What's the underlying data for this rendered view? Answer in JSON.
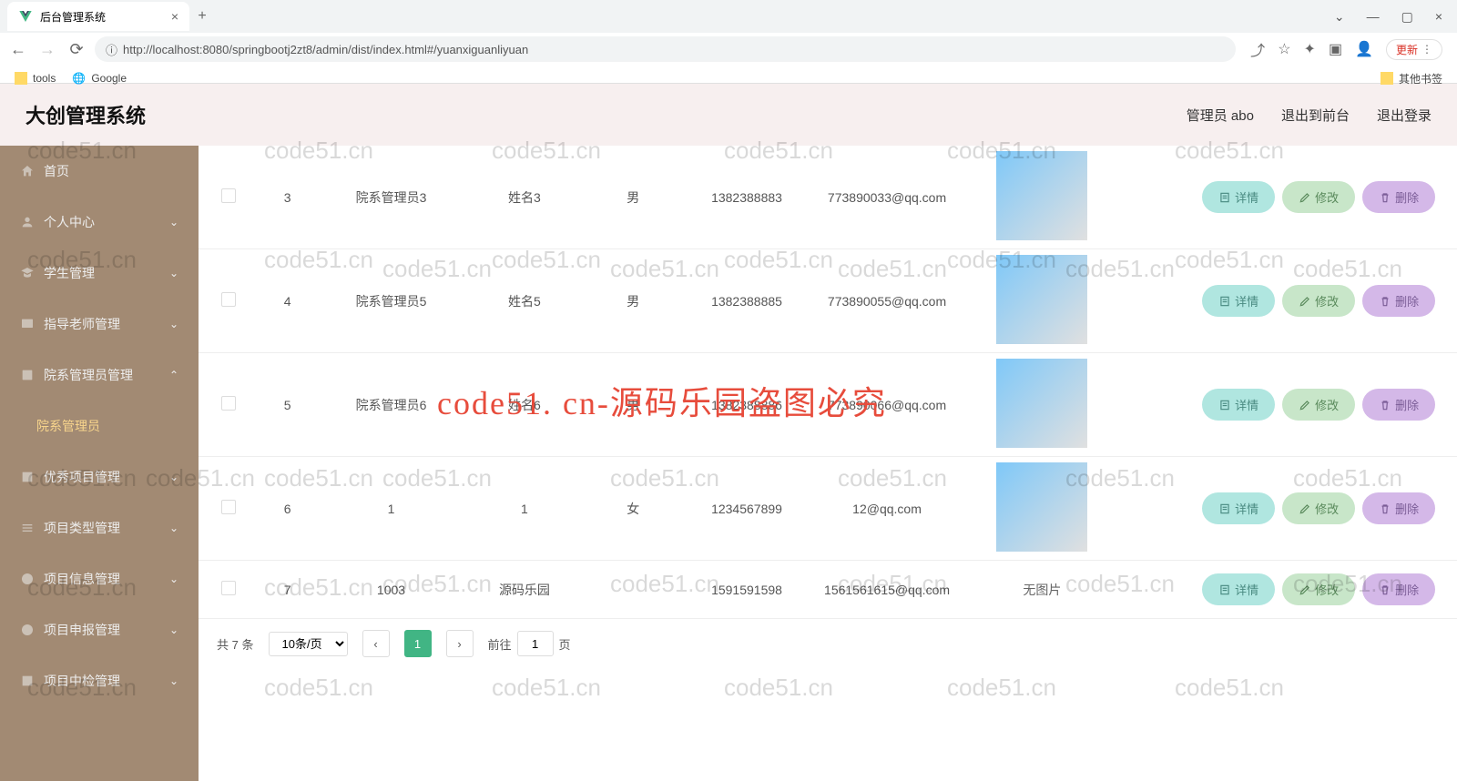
{
  "browser": {
    "tab_title": "后台管理系统",
    "url": "http://localhost:8080/springbootj2zt8/admin/dist/index.html#/yuanxiguanliyuan",
    "update_label": "更新",
    "bookmarks": {
      "tools": "tools",
      "google": "Google",
      "other": "其他书签"
    }
  },
  "header": {
    "app_title": "大创管理系统",
    "user_label": "管理员 abo",
    "logout_front": "退出到前台",
    "logout": "退出登录"
  },
  "sidebar": {
    "items": [
      {
        "label": "首页",
        "icon": "home"
      },
      {
        "label": "个人中心",
        "icon": "user"
      },
      {
        "label": "学生管理",
        "icon": "student"
      },
      {
        "label": "指导老师管理",
        "icon": "teacher"
      },
      {
        "label": "院系管理员管理",
        "icon": "dept",
        "expanded": true
      },
      {
        "label": "院系管理员",
        "icon": "",
        "active": true
      },
      {
        "label": "优秀项目管理",
        "icon": "star"
      },
      {
        "label": "项目类型管理",
        "icon": "type"
      },
      {
        "label": "项目信息管理",
        "icon": "info"
      },
      {
        "label": "项目申报管理",
        "icon": "apply"
      },
      {
        "label": "项目中检管理",
        "icon": "check"
      }
    ]
  },
  "table": {
    "rows": [
      {
        "idx": "3",
        "account": "院系管理员3",
        "name": "姓名3",
        "gender": "男",
        "phone": "1382388883",
        "email": "773890033@qq.com",
        "has_photo": true
      },
      {
        "idx": "4",
        "account": "院系管理员5",
        "name": "姓名5",
        "gender": "男",
        "phone": "1382388885",
        "email": "773890055@qq.com",
        "has_photo": true
      },
      {
        "idx": "5",
        "account": "院系管理员6",
        "name": "姓名6",
        "gender": "男",
        "phone": "1382388886",
        "email": "773890066@qq.com",
        "has_photo": true
      },
      {
        "idx": "6",
        "account": "1",
        "name": "1",
        "gender": "女",
        "phone": "1234567899",
        "email": "12@qq.com",
        "has_photo": true
      },
      {
        "idx": "7",
        "account": "1003",
        "name": "源码乐园",
        "gender": "",
        "phone": "1591591598",
        "email": "1561561615@qq.com",
        "has_photo": false
      }
    ],
    "no_photo_text": "无图片",
    "actions": {
      "detail": "详情",
      "edit": "修改",
      "delete": "删除"
    }
  },
  "pagination": {
    "total_prefix": "共",
    "total": "7",
    "total_suffix": "条",
    "page_size": "10条/页",
    "current": "1",
    "goto_prefix": "前往",
    "goto_value": "1",
    "goto_suffix": "页"
  },
  "watermark": {
    "text": "code51.cn",
    "red_text": "code51. cn-源码乐园盗图必究"
  }
}
